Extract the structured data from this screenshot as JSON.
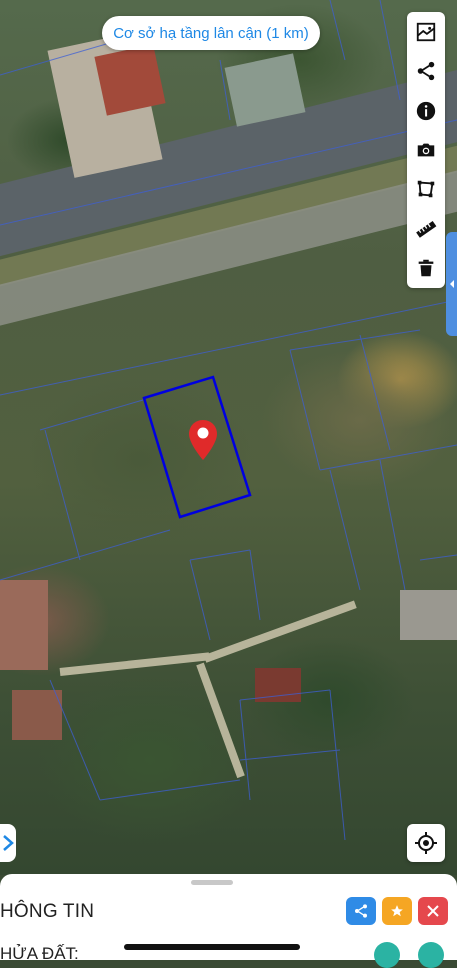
{
  "map": {
    "nearby_chip": "Cơ sở hạ tầng lân cận (1 km)",
    "plot_outline_color": "#0000e0",
    "pin_color": "#e02a2a"
  },
  "toolbar": {
    "tools": [
      {
        "name": "map-layer-icon"
      },
      {
        "name": "share-icon"
      },
      {
        "name": "info-icon"
      },
      {
        "name": "camera-icon"
      },
      {
        "name": "polygon-draw-icon"
      },
      {
        "name": "ruler-icon"
      },
      {
        "name": "trash-icon"
      }
    ]
  },
  "sheet": {
    "title": "HÔNG TIN",
    "subtitle": "HỬA ĐẤT:",
    "actions": {
      "share_color": "#2f8be6",
      "favorite_color": "#f5a623",
      "close_color": "#e5484d"
    }
  }
}
